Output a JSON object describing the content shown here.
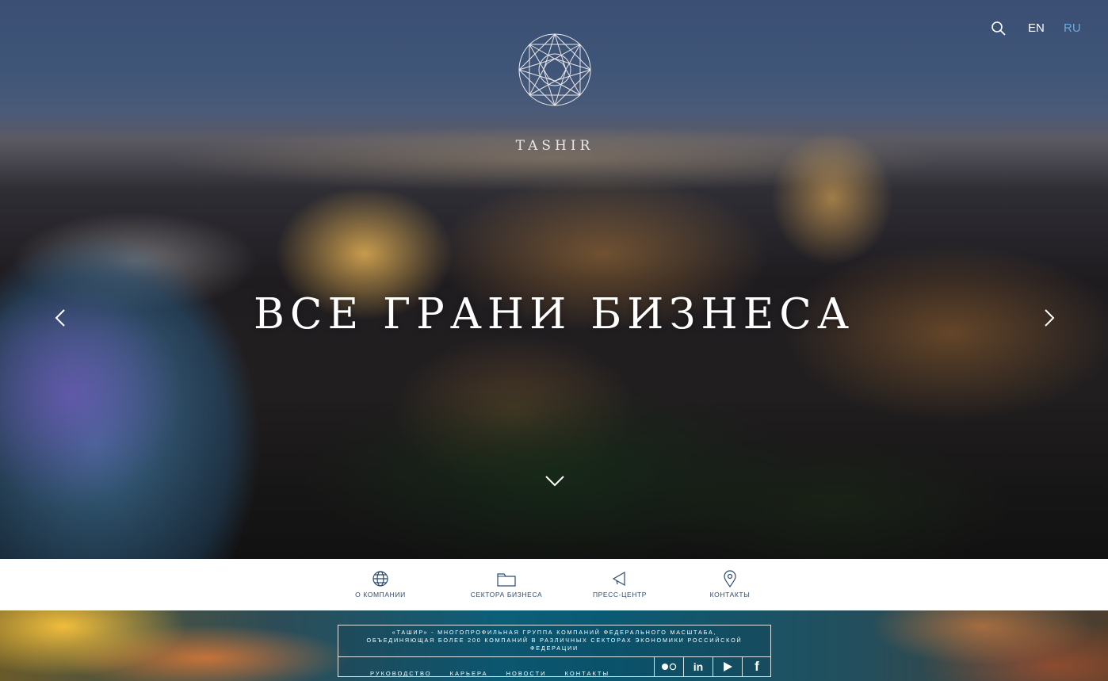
{
  "header": {
    "brand": "TASHIR",
    "lang_en": "EN",
    "lang_ru": "RU",
    "icons": {
      "logo": "tashir-logo",
      "search": "search-icon"
    }
  },
  "hero": {
    "slogan": "ВСЕ ГРАНИ БИЗНЕСА",
    "icons": {
      "prev": "chevron-left-icon",
      "next": "chevron-right-icon",
      "down": "chevron-down-icon"
    }
  },
  "nav": {
    "items": [
      {
        "label": "О КОМПАНИИ",
        "icon": "globe-icon"
      },
      {
        "label": "СЕКТОРА БИЗНЕСА",
        "icon": "folder-icon"
      },
      {
        "label": "ПРЕСС-ЦЕНТР",
        "icon": "megaphone-icon"
      },
      {
        "label": "КОНТАКТЫ",
        "icon": "map-pin-icon"
      }
    ],
    "color": "#2e4a6b"
  },
  "footer": {
    "info_line_1": "«ТАШИР» - МНОГОПРОФИЛЬНАЯ ГРУППА КОМПАНИЙ ФЕДЕРАЛЬНОГО МАСШТАБА,",
    "info_line_2": "ОБЪЕДИНЯЮЩАЯ БОЛЕЕ 200 КОМПАНИЙ В РАЗЛИЧНЫХ СЕКТОРАХ ЭКОНОМИКИ РОССИЙСКОЙ",
    "info_line_3": "ФЕДЕРАЦИИ",
    "links": [
      "РУКОВОДСТВО",
      "КАРЬЕРА",
      "НОВОСТИ",
      "КОНТАКТЫ"
    ],
    "social": {
      "flickr": "flickr-icon",
      "linkedin": "in",
      "youtube": "youtube-icon",
      "facebook": "f"
    }
  },
  "colors": {
    "accent_ru": "#6fa6dd",
    "nav_text": "#2e4a6b"
  }
}
